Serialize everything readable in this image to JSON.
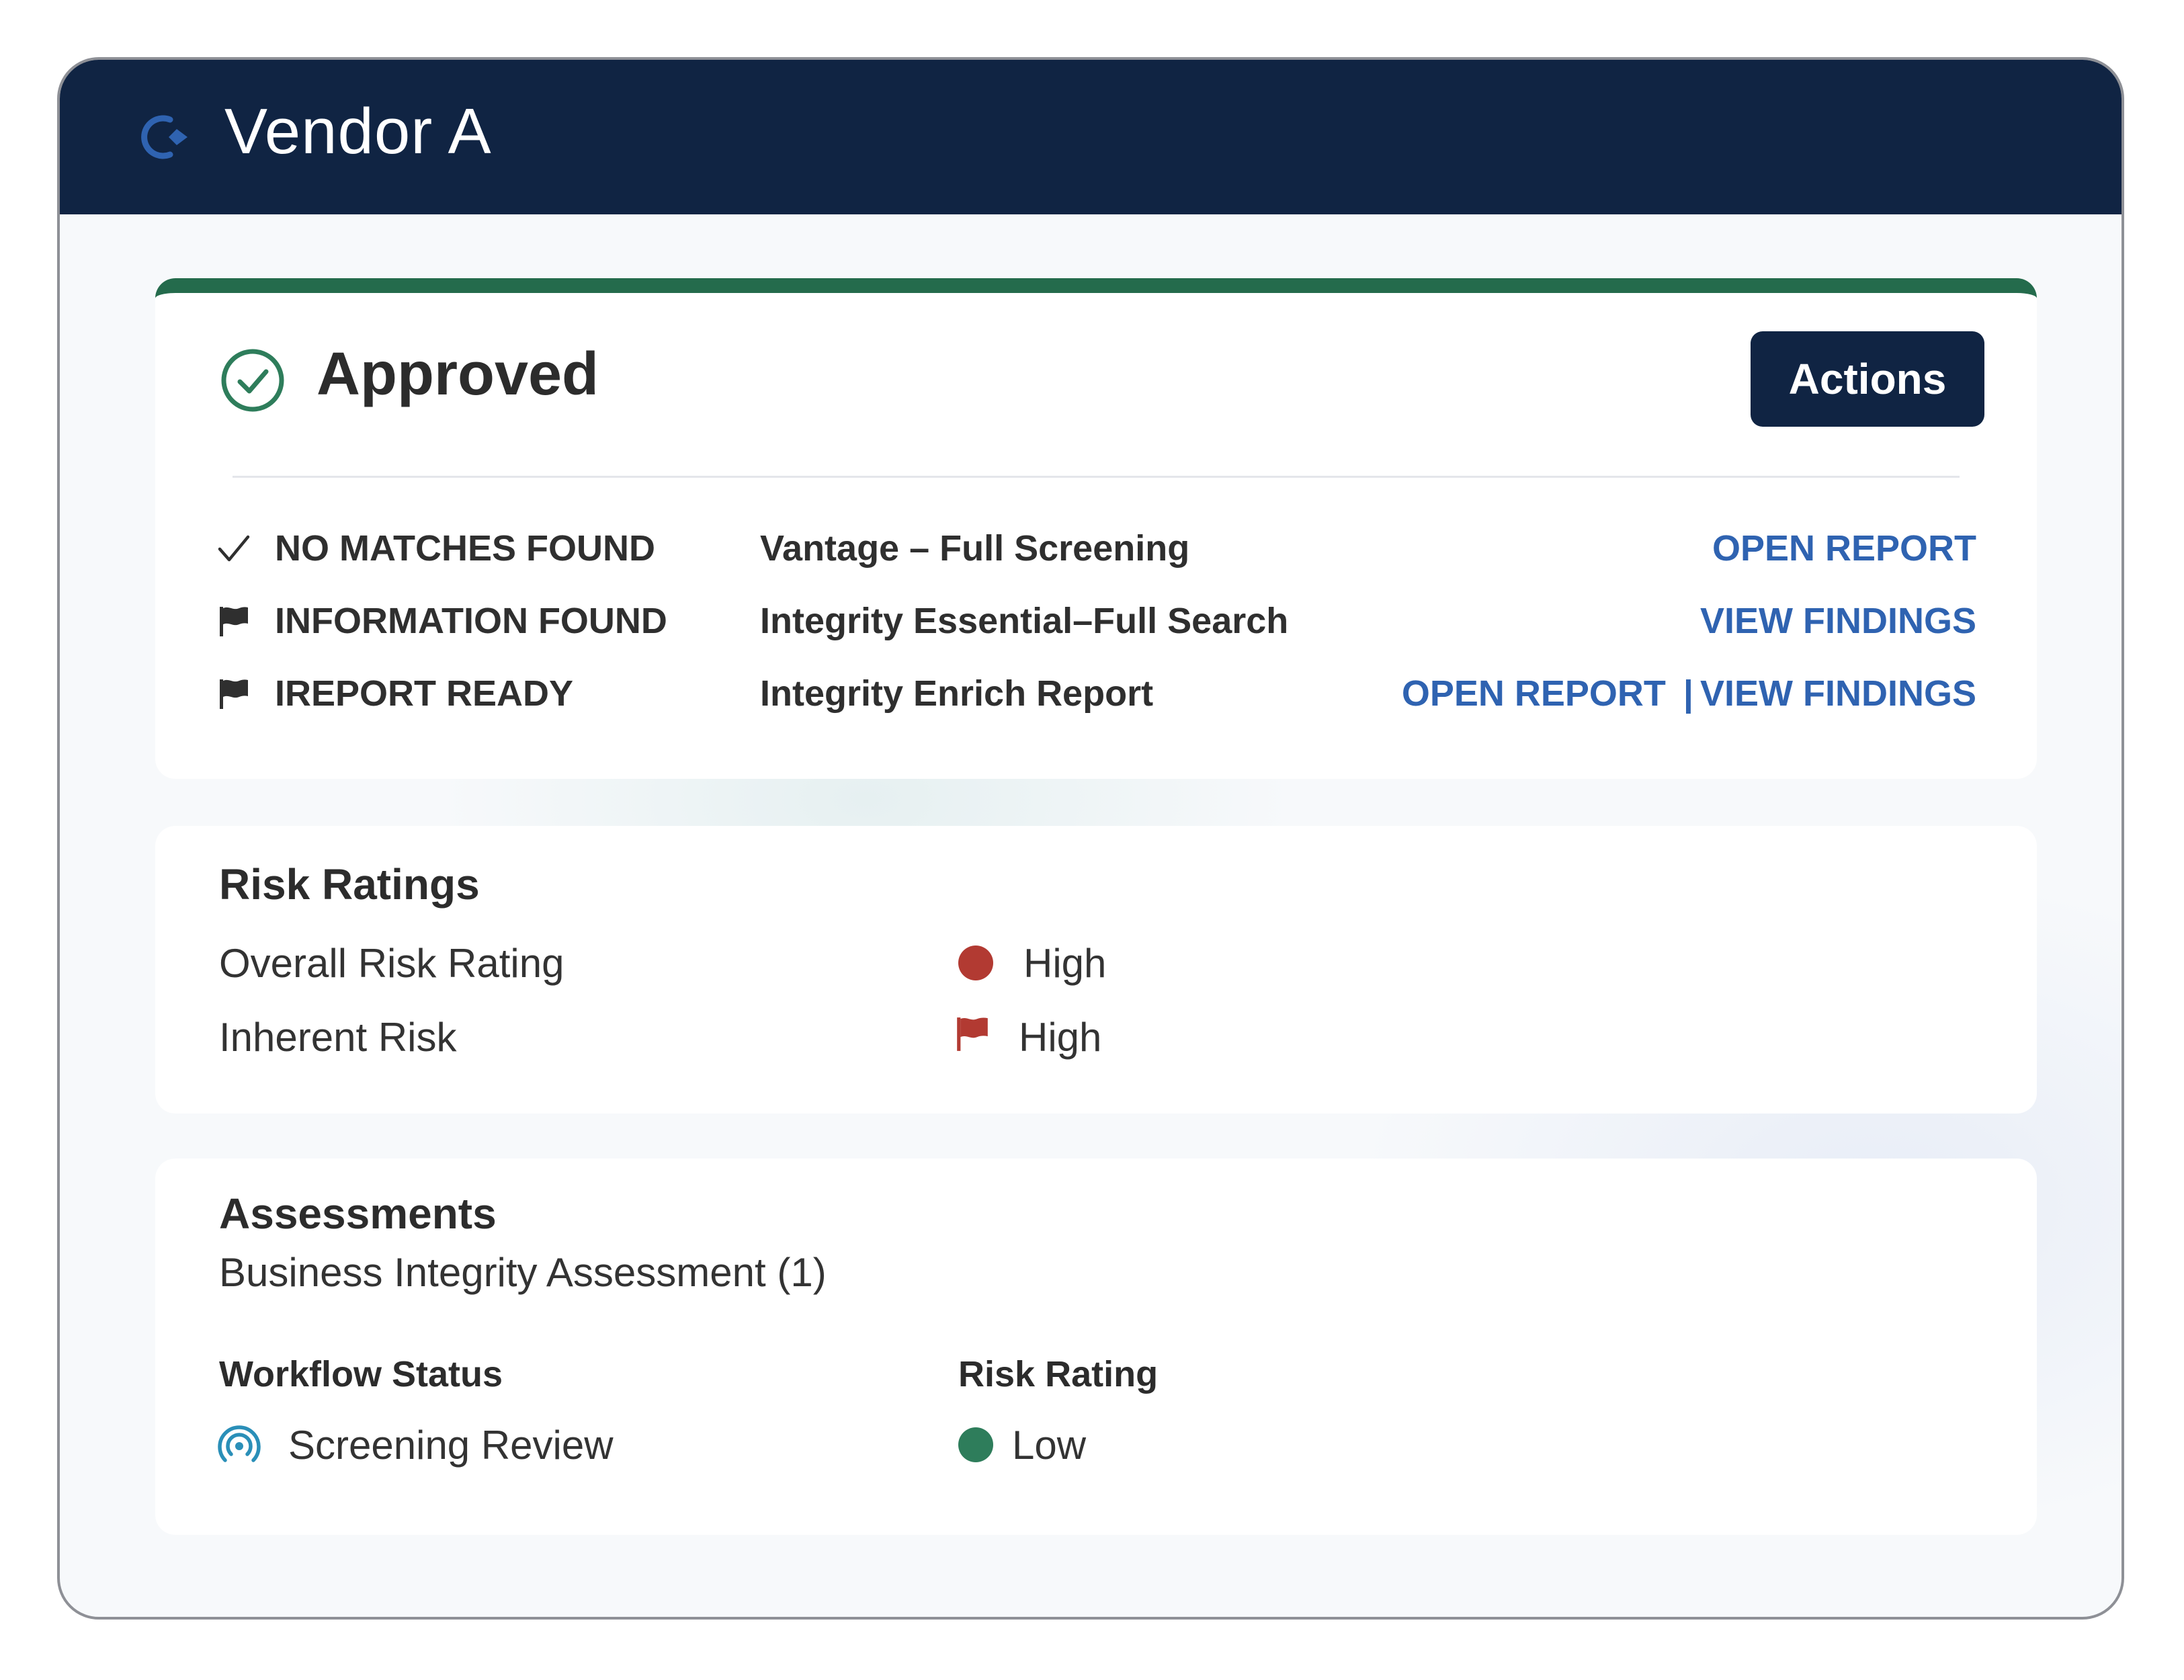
{
  "window": {
    "title": "Vendor A",
    "logo_icon": "compass-brand-icon"
  },
  "status": {
    "title": "Approved",
    "actions_label": "Actions",
    "accent_color": "#246b4c",
    "rows": [
      {
        "icon": "checkmark-icon",
        "status": "NO MATCHES FOUND",
        "product": "Vantage – Full Screening",
        "links": [
          "OPEN REPORT"
        ]
      },
      {
        "icon": "flag-icon",
        "status": "INFORMATION FOUND",
        "product": "Integrity Essential–Full Search",
        "links": [
          "VIEW FINDINGS"
        ]
      },
      {
        "icon": "flag-icon",
        "status": "IREPORT READY",
        "product": "Integrity Enrich Report",
        "links": [
          "OPEN REPORT",
          "VIEW FINDINGS"
        ],
        "separator": "|"
      }
    ]
  },
  "risk": {
    "title": "Risk Ratings",
    "items": [
      {
        "label": "Overall Risk Rating",
        "value": "High",
        "icon": "red-dot-icon",
        "color": "#b23a32"
      },
      {
        "label": "Inherent Risk",
        "value": "High",
        "icon": "red-flag-icon",
        "color": "#b23a32"
      }
    ]
  },
  "assessments": {
    "title": "Assessments",
    "subtitle": "Business Integrity Assessment (1)",
    "workflow_header": "Workflow Status",
    "workflow_value": "Screening Review",
    "workflow_icon": "broadcast-icon",
    "rating_header": "Risk Rating",
    "rating_value": "Low",
    "rating_color": "#2e7d5b"
  },
  "colors": {
    "navy": "#102443",
    "link_blue": "#2f63b1",
    "green": "#246b4c",
    "red": "#b23a32",
    "teal": "#2a8fb8"
  }
}
